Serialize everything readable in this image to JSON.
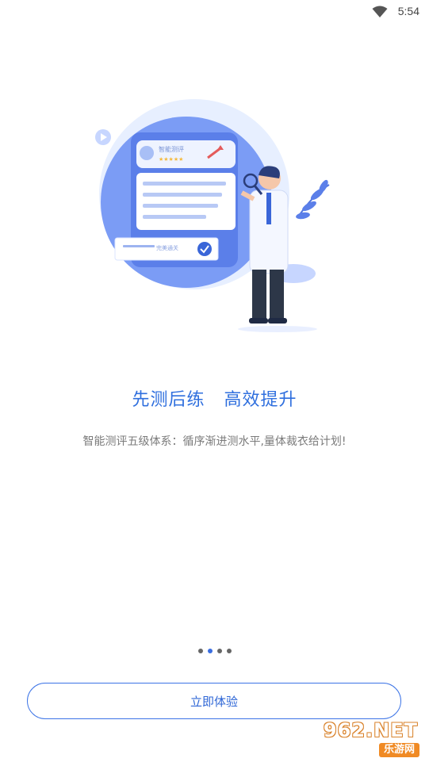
{
  "status_bar": {
    "time": "5:54",
    "wifi_icon": "wifi-icon"
  },
  "illustration": {
    "card_title": "智能测评",
    "card_stars": "★★★★★",
    "badge_text": "完美通关"
  },
  "onboarding": {
    "headline": "先测后练   高效提升",
    "subtitle": "智能测评五级体系：循序渐进测水平,量体裁衣给计划!",
    "page_indicator": {
      "total": 4,
      "active": 2
    }
  },
  "cta": {
    "label": "立即体验"
  },
  "watermark": {
    "top": "962.NET",
    "bottom": "乐游网"
  },
  "colors": {
    "accent": "#2f6fde",
    "illustration_blue": "#7b9cf5",
    "subtitle_gray": "#7b7b7b"
  }
}
